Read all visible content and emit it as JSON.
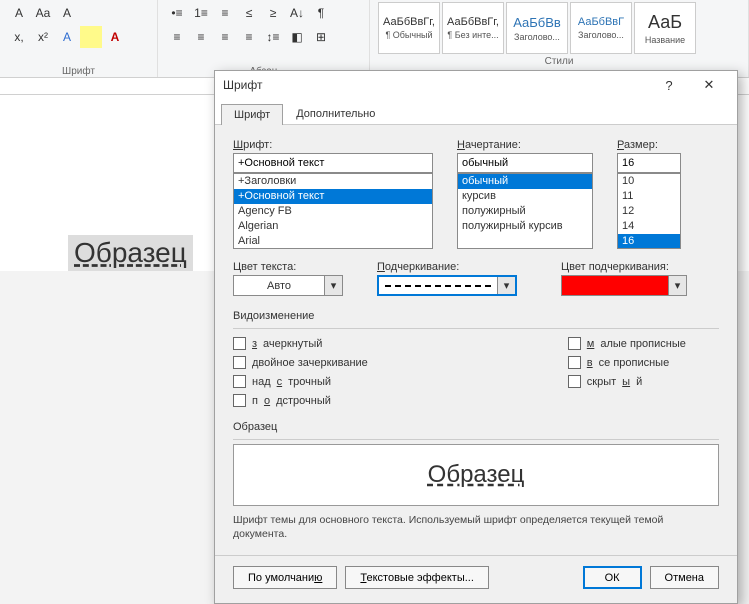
{
  "ribbon": {
    "font_group_label": "Шрифт",
    "para_group_label": "Абзац",
    "styles_group_label": "Стили",
    "styles": [
      {
        "preview": "АаБбВвГг,",
        "label": "¶ Обычный"
      },
      {
        "preview": "АаБбВвГг,",
        "label": "¶ Без инте..."
      },
      {
        "preview": "АаБбВв",
        "label": "Заголово..."
      },
      {
        "preview": "АаБбВвГ",
        "label": "Заголово..."
      },
      {
        "preview": "АаБ",
        "label": "Название"
      }
    ]
  },
  "doc_sample": "Образец",
  "dialog": {
    "title": "Шрифт",
    "tabs": {
      "font": "Шрифт",
      "advanced": "Дополнительно"
    },
    "labels": {
      "font": "Шрифт:",
      "style": "Начертание:",
      "size": "Размер:",
      "font_color": "Цвет текста:",
      "underline_style": "Подчеркивание:",
      "underline_color": "Цвет подчеркивания:",
      "effects": "Видоизменение",
      "preview": "Образец"
    },
    "font_value": "+Основной текст",
    "font_list": [
      "+Заголовки",
      "+Основной текст",
      "Agency FB",
      "Algerian",
      "Arial"
    ],
    "font_selected": "+Основной текст",
    "style_value": "обычный",
    "style_list": [
      "обычный",
      "курсив",
      "полужирный",
      "полужирный курсив"
    ],
    "style_selected": "обычный",
    "size_value": "16",
    "size_list": [
      "10",
      "11",
      "12",
      "14",
      "16"
    ],
    "size_selected": "16",
    "font_color_value": "Авто",
    "effects": {
      "strike": "зачеркнутый",
      "dstrike": "двойное зачеркивание",
      "super": "надстрочный",
      "sub": "подстрочный",
      "smallcaps": "малые прописные",
      "allcaps": "все прописные",
      "hidden": "скрытый"
    },
    "preview_text": "Образец",
    "description": "Шрифт темы для основного текста. Используемый шрифт определяется текущей темой документа.",
    "buttons": {
      "default": "По умолчанию",
      "text_effects": "Текстовые эффекты...",
      "ok": "ОК",
      "cancel": "Отмена"
    }
  }
}
